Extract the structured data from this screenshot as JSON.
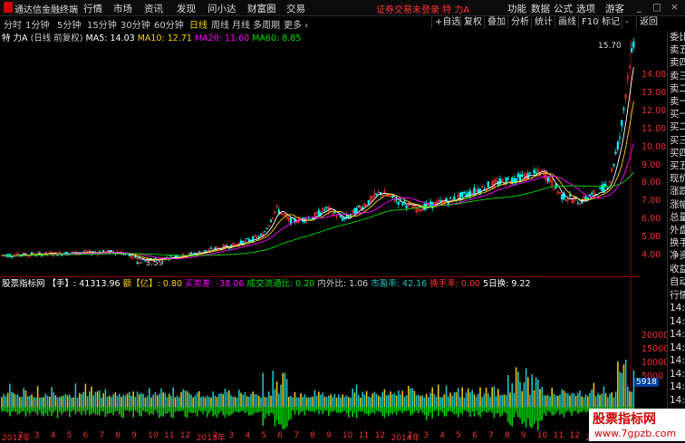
{
  "app": {
    "title": "通达信金融终端"
  },
  "menu": [
    "行情",
    "市场",
    "资讯",
    "发现",
    "问小达",
    "财富圈",
    "交易"
  ],
  "notice": "证券交易未登录  特 力A",
  "top_right": [
    "功能",
    "数据",
    "公式",
    "选项",
    "游客"
  ],
  "periods": [
    "分时",
    "1分钟",
    "5分钟",
    "15分钟",
    "30分钟",
    "60分钟",
    "日线",
    "周线",
    "月线",
    "多周期",
    "更多 ›"
  ],
  "active_period": "日线",
  "right_buttons": [
    "+自选",
    "复权",
    "叠加",
    "分析",
    "统计",
    "画线",
    "F10",
    "标记",
    "-",
    "返回"
  ],
  "main_header": {
    "stock": "特 力A",
    "mode": "(日线 前复权)",
    "ma5": "MA5: 14.03",
    "ma10": "MA10: 12.71",
    "ma20": "MA20: 11.60",
    "ma60": "MA60: 8.85"
  },
  "sub_header": {
    "name": "股票指标网",
    "hand": "【手】: 41313.96",
    "yi": "额【亿】: 0.80",
    "buysell": "买卖差: -38.06",
    "liquid": "成交流通比: 0.20",
    "inout": "内外比: 1.06",
    "pe": "市盈率: 42.16",
    "turnover": "换手率: 0.00",
    "turnover5": "5日换: 9.22"
  },
  "price_ticks": [
    "14.00",
    "13.00",
    "12.00",
    "11.00",
    "10.00",
    "9.00",
    "8.00",
    "7.00",
    "6.00",
    "5.00",
    "4.00"
  ],
  "vol_ticks": [
    "20000",
    "15000",
    "10000",
    "5000"
  ],
  "vol_badge": "5918",
  "high_label": "15.70",
  "low_label": "3.59",
  "x_ticks": [
    "2012年",
    "2",
    "3",
    "4",
    "5",
    "6",
    "7",
    "8",
    "9",
    "10",
    "11",
    "12",
    "2013年",
    "2",
    "3",
    "4",
    "5",
    "6",
    "7",
    "8",
    "9",
    "10",
    "11",
    "12",
    "2014年",
    "2",
    "3",
    "4",
    "5",
    "6",
    "7",
    "8",
    "9",
    "10",
    "11",
    "12",
    "2015年",
    "2",
    "3"
  ],
  "side_panel": [
    "委比",
    "卖五",
    "卖四",
    "卖三",
    "卖二",
    "卖一",
    "买一",
    "买二",
    "买三",
    "买四",
    "买五",
    "现价",
    "涨跌",
    "涨幅",
    "总量",
    "外盘",
    "换手",
    "净资",
    "收益"
  ],
  "side_panel2": [
    "自动",
    "行情",
    "14:5",
    "14:5",
    "14:5",
    "14:5",
    "14:5",
    "14:5",
    "14:5",
    "14:5",
    "14:5",
    "14:5"
  ],
  "watermark": {
    "line1": "股票指标网",
    "line2": "www.7gpzb.com"
  },
  "colors": {
    "up": "#ff3333",
    "down": "#00ffff",
    "ma5": "#ffffff",
    "ma10": "#ffd400",
    "ma20": "#ff00ff",
    "ma60": "#00e000",
    "volup": "#20c0c0",
    "voldown": "#00d000",
    "volbar2": "#e6c200"
  }
}
